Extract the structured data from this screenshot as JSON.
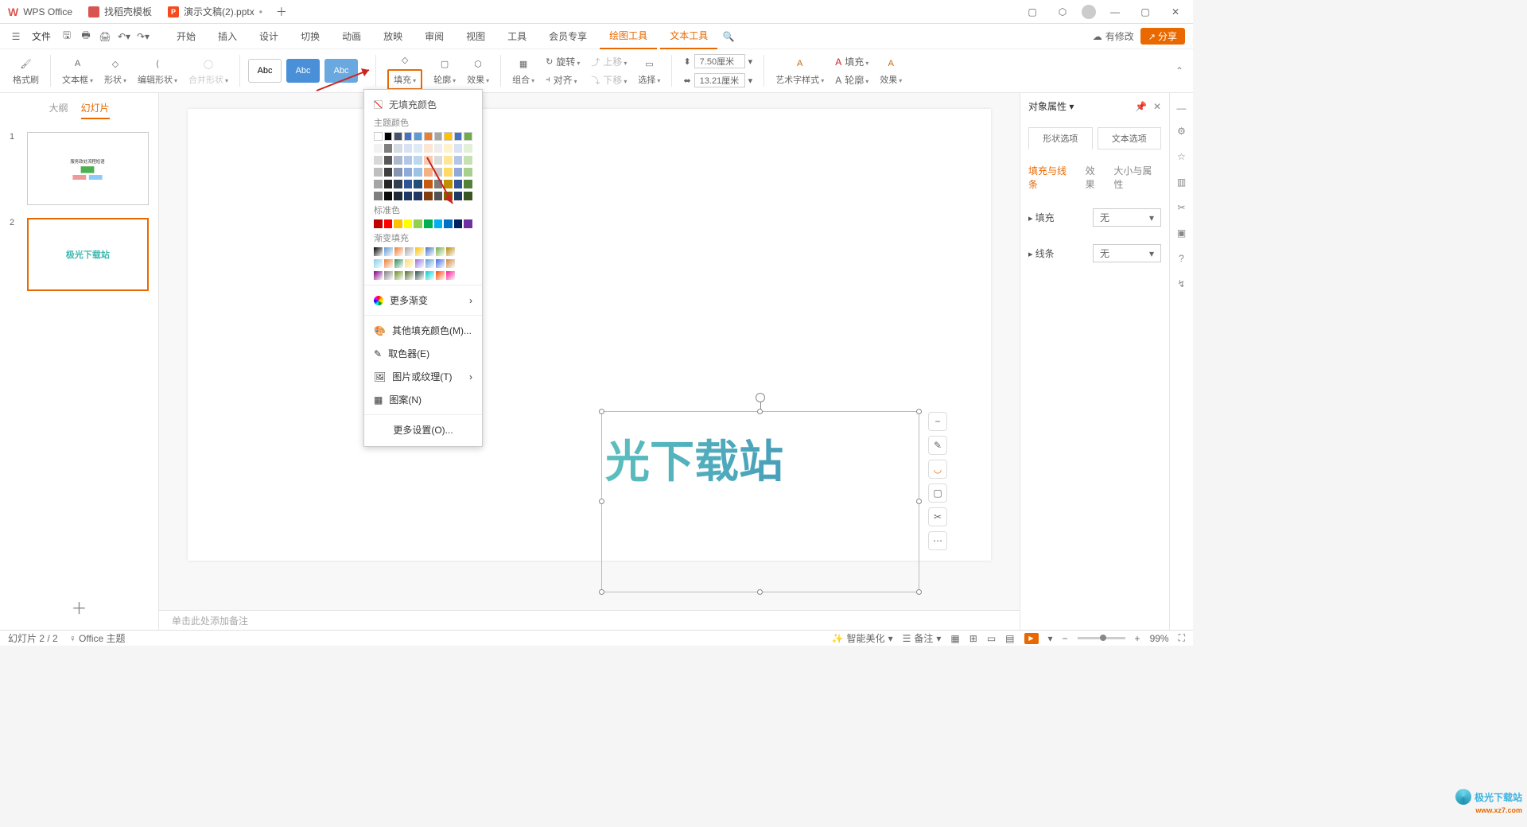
{
  "titlebar": {
    "tabs": [
      {
        "label": "WPS Office",
        "logo": "w"
      },
      {
        "label": "找稻壳模板",
        "logo": "d"
      },
      {
        "label": "演示文稿(2).pptx",
        "logo": "p",
        "closable": true,
        "active": true
      }
    ]
  },
  "menubar": {
    "file": "文件",
    "tabs": [
      "开始",
      "插入",
      "设计",
      "切换",
      "动画",
      "放映",
      "审阅",
      "视图",
      "工具",
      "会员专享"
    ],
    "active_tabs": [
      "绘图工具",
      "文本工具"
    ],
    "pending": "有修改",
    "share": "分享"
  },
  "toolbar": {
    "format_painter": "格式刷",
    "text_box": "文本框",
    "shape": "形状",
    "edit_shape": "编辑形状",
    "merge_shape": "合并形状",
    "style_text": "Abc",
    "fill": "填充",
    "outline": "轮廓",
    "effect": "效果",
    "group": "组合",
    "rotate": "旋转",
    "align": "对齐",
    "bring_fwd": "上移",
    "send_back": "下移",
    "select": "选择",
    "width_val": "7.50厘米",
    "height_val": "13.21厘米",
    "art_style": "艺术字样式",
    "fill2": "填充",
    "outline2": "轮廓",
    "effect2": "效果"
  },
  "fill_popup": {
    "no_fill": "无填充颜色",
    "theme_colors": "主题颜色",
    "standard_colors": "标准色",
    "gradient_fill": "渐变填充",
    "more_gradients": "更多渐变",
    "more_fill": "其他填充颜色(M)...",
    "eyedropper": "取色器(E)",
    "picture_texture": "图片或纹理(T)",
    "pattern": "图案(N)",
    "more_settings": "更多设置(O)..."
  },
  "slides_panel": {
    "outline": "大纲",
    "slides": "幻灯片",
    "slide1_title": "服务政处流程短语",
    "slide2_text": "极光下载站"
  },
  "canvas": {
    "text": "光下载站"
  },
  "notes": "单击此处添加备注",
  "props": {
    "title": "对象属性",
    "shape_options": "形状选项",
    "text_options": "文本选项",
    "subtabs": [
      "填充与线条",
      "效果",
      "大小与属性"
    ],
    "fill_label": "填充",
    "line_label": "线条",
    "none": "无"
  },
  "statusbar": {
    "slide_count": "幻灯片 2 / 2",
    "theme": "Office 主题",
    "smart_beautify": "智能美化",
    "notes": "备注",
    "zoom": "99%"
  },
  "watermark": {
    "text": "极光下载站",
    "url": "www.xz7.com"
  },
  "colors": {
    "theme_row1": [
      "#ffffff",
      "#000000",
      "#44546a",
      "#4472c4",
      "#5b9bd5",
      "#ed7d31",
      "#a5a5a5",
      "#ffc000",
      "#4472c4",
      "#70ad47"
    ],
    "theme_grid": [
      [
        "#f2f2f2",
        "#7f7f7f",
        "#d5dce4",
        "#d9e2f3",
        "#deebf6",
        "#fbe5d5",
        "#ededed",
        "#fff2cc",
        "#d9e2f3",
        "#e2efd9"
      ],
      [
        "#d8d8d8",
        "#595959",
        "#adb9ca",
        "#b4c6e7",
        "#bdd7ee",
        "#f7cbac",
        "#dbdbdb",
        "#fee599",
        "#b4c6e7",
        "#c5e0b3"
      ],
      [
        "#bfbfbf",
        "#3f3f3f",
        "#8496b0",
        "#8eaadb",
        "#9cc3e5",
        "#f4b183",
        "#c9c9c9",
        "#ffd965",
        "#8eaadb",
        "#a8d08d"
      ],
      [
        "#a5a5a5",
        "#262626",
        "#323f4f",
        "#2f5496",
        "#1f4e79",
        "#c55a11",
        "#7b7b7b",
        "#bf9000",
        "#2f5496",
        "#538135"
      ],
      [
        "#7f7f7f",
        "#0c0c0c",
        "#222a35",
        "#1f3864",
        "#1f3864",
        "#833c0b",
        "#525252",
        "#7f6000",
        "#1f3864",
        "#385623"
      ]
    ],
    "standard": [
      "#c00000",
      "#ff0000",
      "#ffc000",
      "#ffff00",
      "#92d050",
      "#00b050",
      "#00b0f0",
      "#0070c0",
      "#002060",
      "#7030a0"
    ],
    "gradients": [
      [
        "#000000",
        "#5b9bd5",
        "#ed7d31",
        "#a5a5a5",
        "#ffc000",
        "#4472c4",
        "#70ad47",
        "#b8860b"
      ],
      [
        "#87ceeb",
        "#ed7d31",
        "#2e8b57",
        "#ffd966",
        "#9370db",
        "#5b9bd5",
        "#4169e1",
        "#cd853f"
      ],
      [
        "#800080",
        "#808080",
        "#6b8e23",
        "#556b2f",
        "#2f4f4f",
        "#00ced1",
        "#ff4500",
        "#ff1493"
      ]
    ]
  }
}
